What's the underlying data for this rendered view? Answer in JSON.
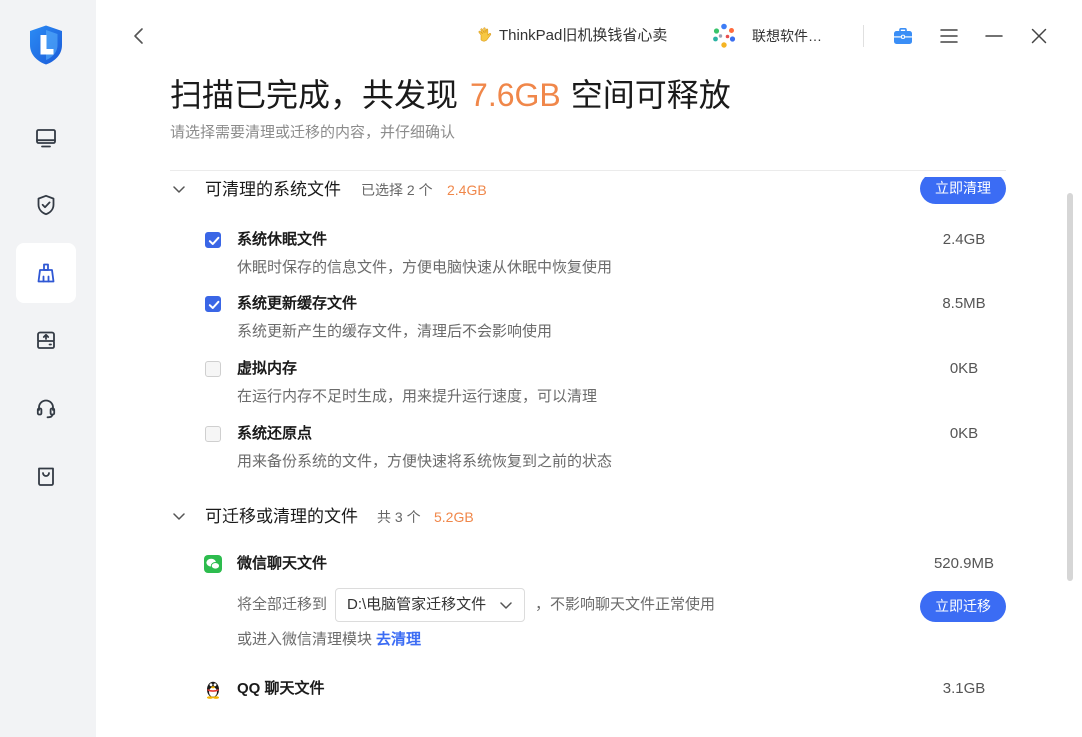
{
  "colors": {
    "accent": "#3b6cf4",
    "highlight": "#f0874a",
    "checkbox": "#3a66e6",
    "sidebar_bg": "#f2f3f5",
    "wechat": "#2dbc4e"
  },
  "sidebar": {
    "logo_icon": "lenovo-shield-logo",
    "items": [
      {
        "icon": "laptop-icon",
        "active": false
      },
      {
        "icon": "shield-check-icon",
        "active": false
      },
      {
        "icon": "broom-icon",
        "active": true
      },
      {
        "icon": "upload-drive-icon",
        "active": false
      },
      {
        "icon": "headset-icon",
        "active": false
      },
      {
        "icon": "shopping-bag-icon",
        "active": false
      }
    ]
  },
  "topbar": {
    "back_icon": "chevron-left-icon",
    "promo": {
      "icon": "waving-hand-icon",
      "text": "ThinkPad旧机换钱省心卖"
    },
    "app_link": {
      "icon": "app-store-icon",
      "text": "联想软件…"
    },
    "actions": [
      "toolbox-icon",
      "menu-icon",
      "minimize-icon",
      "close-icon"
    ]
  },
  "header": {
    "title_prefix": "扫描已完成，共发现",
    "title_highlight": "7.6GB",
    "title_suffix": "空间可释放",
    "subtitle": "请选择需要清理或迁移的内容，并仔细确认"
  },
  "system_files": {
    "expand_icon": "chevron-down-icon",
    "title": "可清理的系统文件",
    "selected_text": "已选择 2 个",
    "selected_size": "2.4GB",
    "action_label": "立即清理",
    "items": [
      {
        "name": "系统休眠文件",
        "desc": "休眠时保存的信息文件，方便电脑快速从休眠中恢复使用",
        "size": "2.4GB",
        "checked": true
      },
      {
        "name": "系统更新缓存文件",
        "desc": "系统更新产生的缓存文件，清理后不会影响使用",
        "size": "8.5MB",
        "checked": true
      },
      {
        "name": "虚拟内存",
        "desc": "在运行内存不足时生成，用来提升运行速度，可以清理",
        "size": "0KB",
        "checked": false
      },
      {
        "name": "系统还原点",
        "desc": "用来备份系统的文件，方便快速将系统恢复到之前的状态",
        "size": "0KB",
        "checked": false
      }
    ]
  },
  "migratable_files": {
    "expand_icon": "chevron-down-icon",
    "title": "可迁移或清理的文件",
    "count_text": "共 3 个",
    "total_size": "5.2GB",
    "wechat": {
      "icon": "wechat-icon",
      "name": "微信聊天文件",
      "size": "520.9MB",
      "migrate_prefix": "将全部迁移到",
      "target_path": "D:\\电脑管家迁移文件",
      "migrate_note": "，不影响聊天文件正常使用",
      "action_label": "立即迁移",
      "clean_prefix": "或进入微信清理模块",
      "clean_link": "去清理"
    },
    "qq": {
      "icon": "qq-penguin-icon",
      "name": "QQ 聊天文件",
      "size": "3.1GB"
    }
  }
}
